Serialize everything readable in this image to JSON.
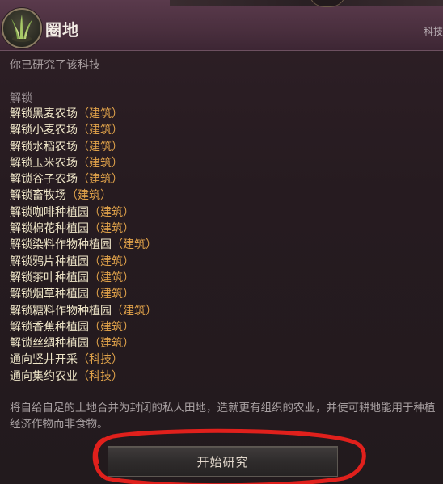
{
  "header": {
    "title": "圈地",
    "category": "科技"
  },
  "status": {
    "researched": "你已研究了该科技"
  },
  "unlocks": {
    "heading": "解锁",
    "items": [
      {
        "text": "解锁黑麦农场",
        "kind": "（建筑）"
      },
      {
        "text": "解锁小麦农场",
        "kind": "（建筑）"
      },
      {
        "text": "解锁水稻农场",
        "kind": "（建筑）"
      },
      {
        "text": "解锁玉米农场",
        "kind": "（建筑）"
      },
      {
        "text": "解锁谷子农场",
        "kind": "（建筑）"
      },
      {
        "text": "解锁畜牧场",
        "kind": "（建筑）"
      },
      {
        "text": "解锁咖啡种植园",
        "kind": "（建筑）"
      },
      {
        "text": "解锁棉花种植园",
        "kind": "（建筑）"
      },
      {
        "text": "解锁染料作物种植园",
        "kind": "（建筑）"
      },
      {
        "text": "解锁鸦片种植园",
        "kind": "（建筑）"
      },
      {
        "text": "解锁茶叶种植园",
        "kind": "（建筑）"
      },
      {
        "text": "解锁烟草种植园",
        "kind": "（建筑）"
      },
      {
        "text": "解锁糖料作物种植园",
        "kind": "（建筑）"
      },
      {
        "text": "解锁香蕉种植园",
        "kind": "（建筑）"
      },
      {
        "text": "解锁丝绸种植园",
        "kind": "（建筑）"
      },
      {
        "text": "通向竖井开采",
        "kind": "（科技）"
      },
      {
        "text": "通向集约农业",
        "kind": "（科技）"
      }
    ]
  },
  "description": "将自给自足的土地合并为封闭的私人田地，造就更有组织的农业，并使可耕地能用于种植经济作物而非食物。",
  "actions": {
    "start_research": "开始研究"
  },
  "colors": {
    "unlock_text": "#efe6c8",
    "unlock_kind": "#e0a24a",
    "header_bg": "#4a2f3e",
    "annotation": "#e0201c"
  },
  "icons": {
    "tech_icon": "grass-tuft-icon"
  }
}
